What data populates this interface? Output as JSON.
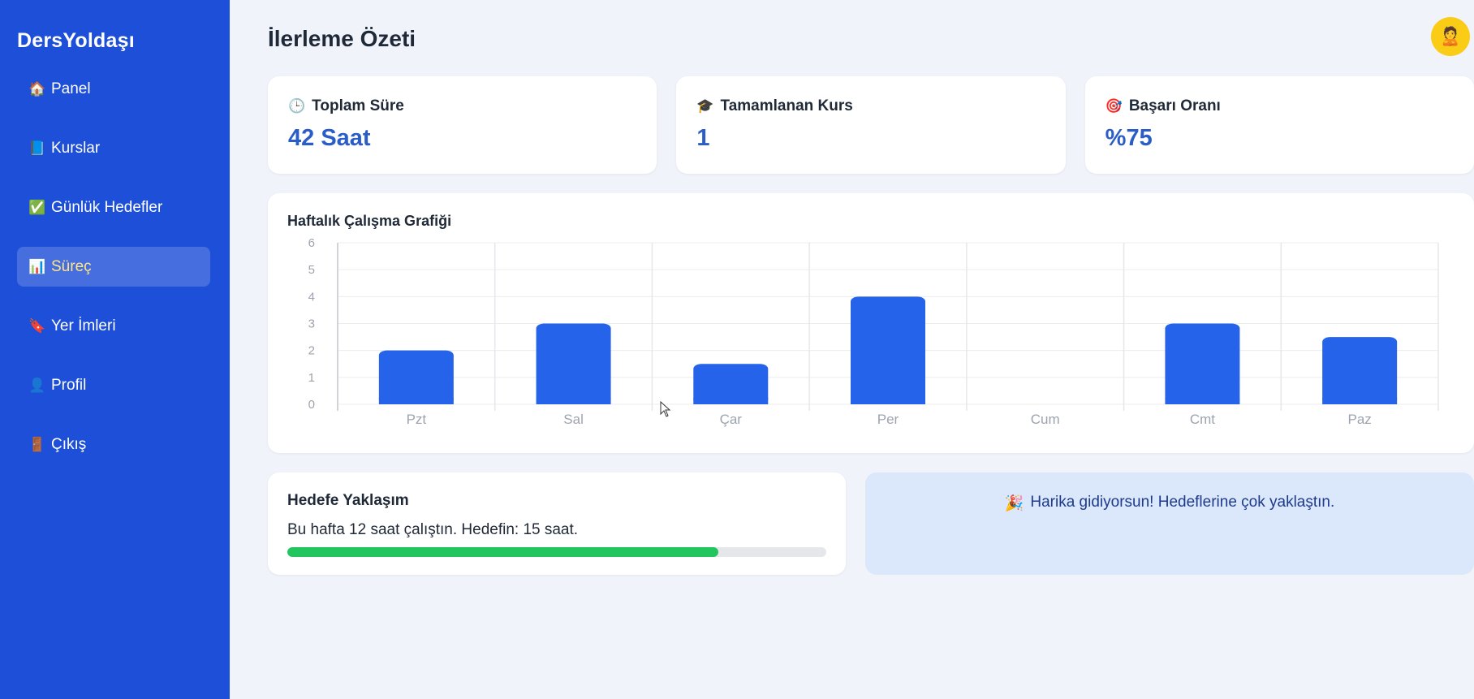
{
  "brand": "DersYoldaşı",
  "sidebar": {
    "items": [
      {
        "icon": "🏠",
        "label": "Panel"
      },
      {
        "icon": "📘",
        "label": "Kurslar"
      },
      {
        "icon": "✅",
        "label": "Günlük Hedefler"
      },
      {
        "icon": "📊",
        "label": "Süreç"
      },
      {
        "icon": "🔖",
        "label": "Yer İmleri"
      },
      {
        "icon": "👤",
        "label": "Profil"
      },
      {
        "icon": "🚪",
        "label": "Çıkış"
      }
    ],
    "active_index": 3
  },
  "header": {
    "title": "İlerleme Özeti",
    "avatar_icon": "🙎"
  },
  "stats": [
    {
      "icon": "🕒",
      "label": "Toplam Süre",
      "value": "42 Saat"
    },
    {
      "icon": "🎓",
      "label": "Tamamlanan Kurs",
      "value": "1"
    },
    {
      "icon": "🎯",
      "label": "Başarı Oranı",
      "value": "%75"
    }
  ],
  "chart": {
    "title": "Haftalık Çalışma Grafiği"
  },
  "chart_data": {
    "type": "bar",
    "title": "Haftalık Çalışma Grafiği",
    "categories": [
      "Pzt",
      "Sal",
      "Çar",
      "Per",
      "Cum",
      "Cmt",
      "Paz"
    ],
    "values": [
      2,
      3,
      1.5,
      4,
      0,
      3,
      2.5
    ],
    "ylim": [
      0,
      6
    ],
    "yticks": [
      0,
      1,
      2,
      3,
      4,
      5,
      6
    ],
    "grid": true,
    "bar_color": "#2563eb"
  },
  "goal": {
    "title": "Hedefe Yaklaşım",
    "text": "Bu hafta 12 saat çalıştın. Hedefin: 15 saat.",
    "progress": 0.8,
    "progress_color": "#22c55e"
  },
  "message": {
    "icon": "🎉",
    "text": "Harika gidiyorsun! Hedeflerine çok yaklaştın."
  }
}
